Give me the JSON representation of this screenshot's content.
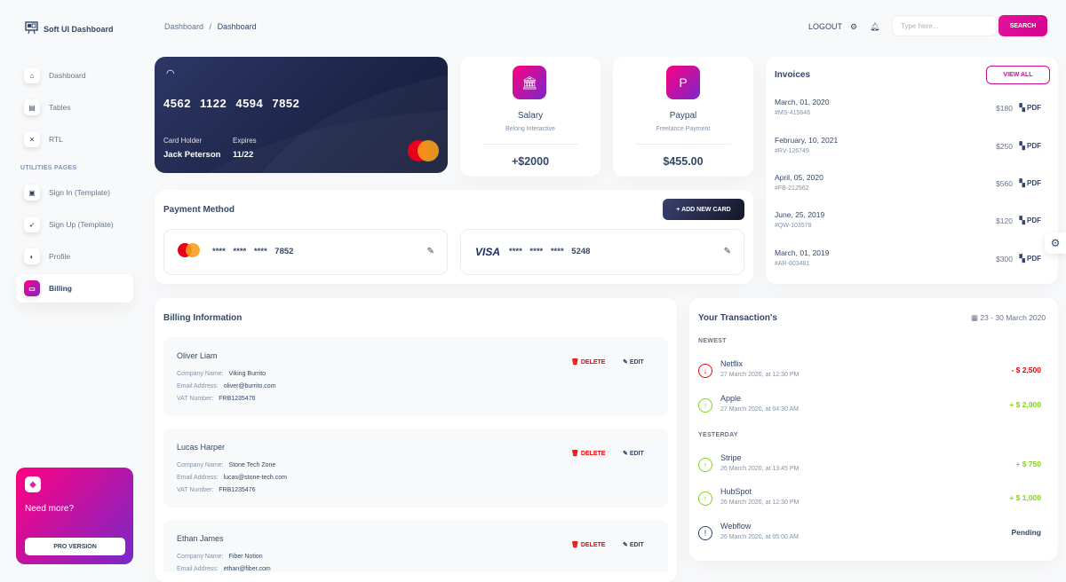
{
  "brand": {
    "name": "Soft UI Dashboard"
  },
  "sidebar": {
    "items": [
      {
        "label": "Dashboard"
      },
      {
        "label": "Tables"
      },
      {
        "label": "RTL"
      },
      {
        "label": "Sign In (Template)"
      },
      {
        "label": "Sign Up (Template)"
      },
      {
        "label": "Profile"
      },
      {
        "label": "Billing"
      }
    ],
    "section": "UTILITIES PAGES",
    "need_more": {
      "title": "Need more?",
      "button": "PRO VERSION"
    }
  },
  "header": {
    "breadcrumb": [
      "Dashboard",
      "/",
      "Dashboard"
    ],
    "logout": "LOGOUT",
    "search_placeholder": "Type here...",
    "search_button": "SEARCH"
  },
  "credit_card": {
    "number": "4562 1122 4594 7852",
    "holder_label": "Card Holder",
    "holder": "Jack Peterson",
    "expires_label": "Expires",
    "expires": "11/22"
  },
  "stats": [
    {
      "title": "Salary",
      "subtitle": "Belong Interactive",
      "value": "+$2000"
    },
    {
      "title": "Paypal",
      "subtitle": "Freelance Payment",
      "value": "$455.00"
    }
  ],
  "payment": {
    "title": "Payment Method",
    "add_button": "+ ADD NEW CARD",
    "cards": [
      {
        "brand": "mastercard",
        "digits": "**** **** **** 7852"
      },
      {
        "brand": "VISA",
        "digits": "**** **** **** 5248"
      }
    ]
  },
  "invoices": {
    "title": "Invoices",
    "view_all": "VIEW ALL",
    "rows": [
      {
        "date": "March, 01, 2020",
        "id": "#MS-415646",
        "amount": "$180",
        "pdf": "PDF"
      },
      {
        "date": "February, 10, 2021",
        "id": "#RV-126749",
        "amount": "$250",
        "pdf": "PDF"
      },
      {
        "date": "April, 05, 2020",
        "id": "#FB-212562",
        "amount": "$560",
        "pdf": "PDF"
      },
      {
        "date": "June, 25, 2019",
        "id": "#QW-103578",
        "amount": "$120",
        "pdf": "PDF"
      },
      {
        "date": "March, 01, 2019",
        "id": "#AR-803481",
        "amount": "$300",
        "pdf": "PDF"
      }
    ]
  },
  "billing": {
    "title": "Billing Information",
    "labels": {
      "company": "Company Name:",
      "email": "Email Address:",
      "vat": "VAT Number:",
      "delete": "DELETE",
      "edit": "EDIT"
    },
    "entries": [
      {
        "name": "Oliver Liam",
        "company": "Viking Burrito",
        "email": "oliver@burrito.com",
        "vat": "FRB1235476"
      },
      {
        "name": "Lucas Harper",
        "company": "Stone Tech Zone",
        "email": "lucas@stone-tech.com",
        "vat": "FRB1235476"
      },
      {
        "name": "Ethan James",
        "company": "Fiber Notion",
        "email": "ethan@fiber.com",
        "vat": ""
      }
    ]
  },
  "transactions": {
    "title": "Your Transaction's",
    "range": "23 - 30 March 2020",
    "newest_label": "NEWEST",
    "yesterday_label": "YESTERDAY",
    "newest": [
      {
        "name": "Netflix",
        "date": "27 March 2020, at 12:30 PM",
        "amount": "- $ 2,500",
        "type": "minus"
      },
      {
        "name": "Apple",
        "date": "27 March 2020, at 04:30 AM",
        "amount": "+ $ 2,000",
        "type": "plus"
      }
    ],
    "yesterday": [
      {
        "name": "Stripe",
        "date": "26 March 2020, at 13:45 PM",
        "amount": "+ $ 750",
        "type": "plus"
      },
      {
        "name": "HubSpot",
        "date": "26 March 2020, at 12:30 PM",
        "amount": "+ $ 1,000",
        "type": "plus"
      },
      {
        "name": "Webflow",
        "date": "26 March 2020, at 05:00 AM",
        "amount": "Pending",
        "type": "pending"
      }
    ]
  },
  "colors": {
    "accent": "#cb0c9f",
    "negative": "#ea0606",
    "positive": "#82d616",
    "dark": "#344767"
  }
}
